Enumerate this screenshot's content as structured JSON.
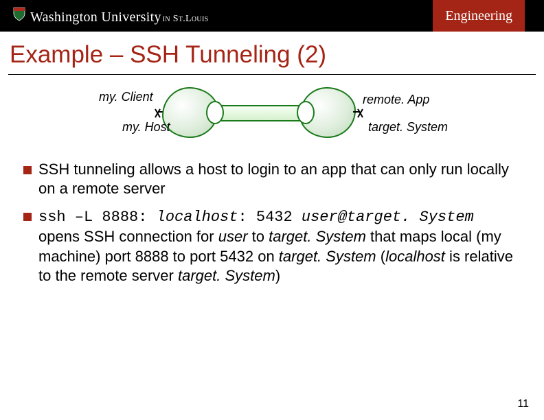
{
  "header": {
    "university_main": "Washington University",
    "university_sub": "in St.Louis",
    "engineering": "Engineering"
  },
  "title": "Example – SSH Tunneling (2)",
  "diagram": {
    "my_client": "my. Client",
    "my_host": "my. Host",
    "remote_app": "remote. App",
    "target_system": "target. System"
  },
  "bullets": {
    "b1": {
      "text": "SSH tunneling allows a host to login to an app that can only run locally on a remote server"
    },
    "b2": {
      "cmd_prefix": "ssh –L 8888: ",
      "cmd_host": "localhost",
      "cmd_mid": ": 5432 ",
      "cmd_user": "user@target. System",
      "expl_1": "opens SSH connection for ",
      "user_word": "user",
      "expl_2": " to ",
      "ts1": "target. System",
      "expl_3": " that maps local (my machine) port 8888 to port 5432 on ",
      "ts2": "target. System",
      "expl_4": " (",
      "lh": "localhost",
      "expl_5": " is relative to the remote server ",
      "ts3": "target. System",
      "expl_6": ")"
    }
  },
  "page_number": "11"
}
